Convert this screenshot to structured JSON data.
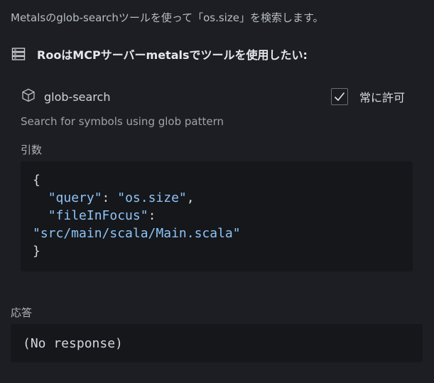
{
  "intro_text": "Metalsのglob-searchツールを使って「os.size」を検索します。",
  "header": {
    "icon": "server-icon",
    "title": "RooはMCPサーバーmetalsでツールを使用したい:"
  },
  "tool": {
    "icon": "cube-icon",
    "name": "glob-search",
    "description": "Search for symbols using glob pattern"
  },
  "always_allow": {
    "label": "常に許可",
    "checked": true
  },
  "arguments": {
    "label": "引数",
    "open_brace": "{",
    "query_key": "\"query\"",
    "query_value": "\"os.size\"",
    "file_key": "\"fileInFocus\"",
    "file_value": "\"src/main/scala/Main.scala\"",
    "close_brace": "}"
  },
  "response": {
    "label": "応答",
    "text": "(No response)"
  }
}
